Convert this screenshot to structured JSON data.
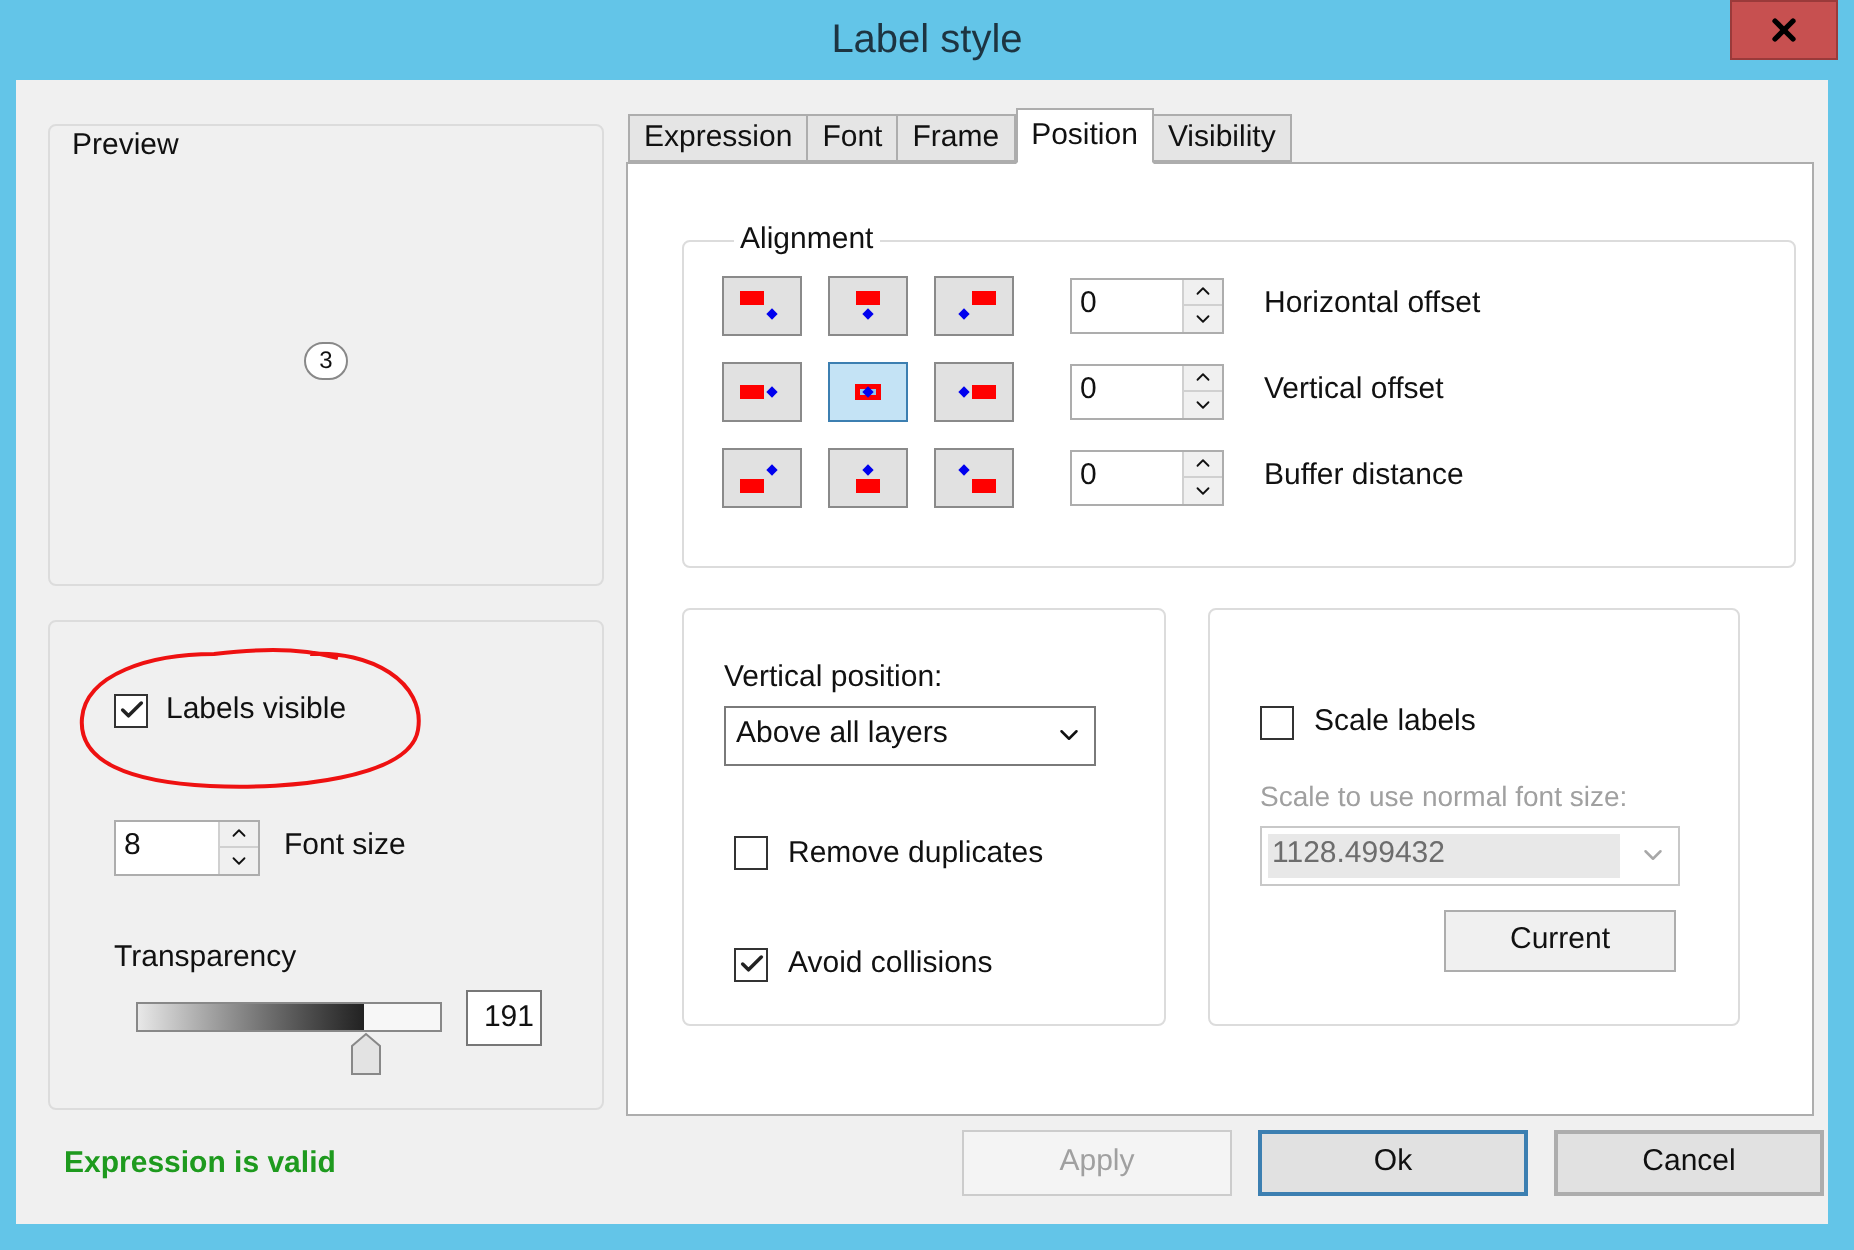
{
  "window": {
    "title": "Label style"
  },
  "preview": {
    "title": "Preview",
    "sample": "3"
  },
  "display": {
    "labels_visible": {
      "label": "Labels visible",
      "checked": true
    },
    "font_size": {
      "value": "8",
      "label": "Font size"
    },
    "transparency": {
      "label": "Transparency",
      "level": 0.75,
      "value": "191"
    }
  },
  "status": "Expression is valid",
  "tabs": [
    {
      "label": "Expression",
      "selected": false
    },
    {
      "label": "Font",
      "selected": false
    },
    {
      "label": "Frame",
      "selected": false
    },
    {
      "label": "Position",
      "selected": true
    },
    {
      "label": "Visibility",
      "selected": false
    }
  ],
  "alignment": {
    "title": "Alignment",
    "buttons": [
      {
        "selected": false
      },
      {
        "selected": false
      },
      {
        "selected": false
      },
      {
        "selected": false
      },
      {
        "selected": true
      },
      {
        "selected": false
      },
      {
        "selected": false
      },
      {
        "selected": false
      },
      {
        "selected": false
      }
    ],
    "offsets": [
      {
        "value": "0",
        "label": "Horizontal offset"
      },
      {
        "value": "0",
        "label": "Vertical offset"
      },
      {
        "value": "0",
        "label": "Buffer distance"
      }
    ]
  },
  "layering": {
    "label": "Vertical position:",
    "value": "Above all layers",
    "options": [
      {
        "label": "Remove duplicates",
        "checked": false
      },
      {
        "label": "Avoid collisions",
        "checked": true
      }
    ]
  },
  "scale": {
    "checkbox": {
      "label": "Scale labels",
      "checked": false
    },
    "field_label": "Scale to use normal font size:",
    "value": "1128.499432",
    "disabled": true,
    "button": "Current"
  },
  "buttons": [
    {
      "label": "Apply",
      "disabled": true,
      "focused": false
    },
    {
      "label": "Ok",
      "disabled": false,
      "focused": true
    },
    {
      "label": "Cancel",
      "disabled": false,
      "focused": false
    }
  ]
}
